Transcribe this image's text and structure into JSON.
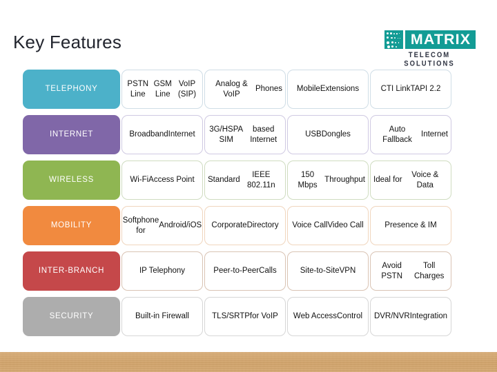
{
  "slide": {
    "title": "Key Features",
    "title_color": "#22252e",
    "background_color": "#ffffff",
    "bottom_band_color": "#d8ab70"
  },
  "logo": {
    "mark_icon": "dot-matrix-icon",
    "wordmark": "MATRIX",
    "tagline": "TELECOM SOLUTIONS",
    "brand_color": "#139c95",
    "tagline_color": "#2d3240"
  },
  "table": {
    "rows": [
      {
        "label": "TELEPHONY",
        "label_color": "#4cb1c9",
        "cell_border_color": "#cfdde6",
        "cells": [
          "PSTN Line\nGSM Line\nVoIP (SIP)",
          "Analog & VoIP\nPhones",
          "Mobile\nExtensions",
          "CTI Link\nTAPI 2.2"
        ]
      },
      {
        "label": "INTERNET",
        "label_color": "#8067a8",
        "cell_border_color": "#cfc9e2",
        "cells": [
          "Broadband\nInternet",
          "3G/HSPA SIM\nbased Internet",
          "USB\nDongles",
          "Auto Fallback\nInternet"
        ]
      },
      {
        "label": "WIRELESS",
        "label_color": "#8fb652",
        "cell_border_color": "#cfdcc0",
        "cells": [
          "Wi-Fi\nAccess Point",
          "Standard\nIEEE 802.11n",
          "150 Mbps\nThroughput",
          "Ideal for\nVoice & Data"
        ]
      },
      {
        "label": "MOBILITY",
        "label_color": "#f18a3f",
        "cell_border_color": "#f0d5bd",
        "cells": [
          "Softphone for\nAndroid/iOS",
          "Corporate\nDirectory",
          "Voice Call\nVideo Call",
          "Presence & IM"
        ]
      },
      {
        "label": "INTER-\nBRANCH",
        "label_color": "#c5484a",
        "cell_border_color": "#d9c3b3",
        "cells": [
          "IP Telephony",
          "Peer-to-Peer\nCalls",
          "Site-to-Site\nVPN",
          "Avoid PSTN\nToll Charges"
        ]
      },
      {
        "label": "SECURITY",
        "label_color": "#adadad",
        "cell_border_color": "#d6d6d6",
        "cells": [
          "Built-in Firewall",
          "TLS/SRTP\nfor VoIP",
          "Web Access\nControl",
          "DVR/NVR\nIntegration"
        ]
      }
    ]
  }
}
